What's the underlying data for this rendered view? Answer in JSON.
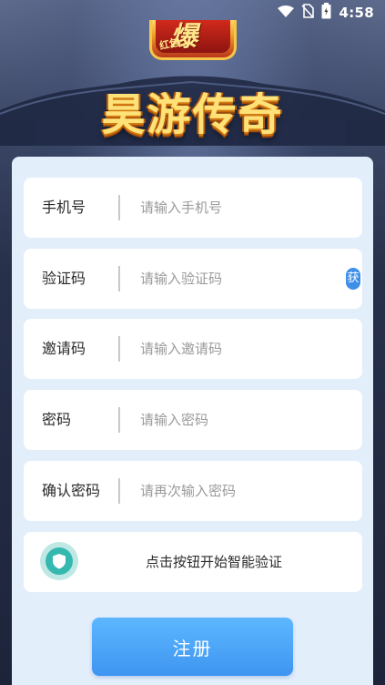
{
  "status_bar": {
    "time": "4:58",
    "icons": [
      "wifi-icon",
      "no-sim-icon",
      "battery-icon"
    ]
  },
  "header": {
    "logo_text": "爆",
    "logo_badge_text": "红包",
    "app_title": "昊游传奇"
  },
  "form": {
    "fields": [
      {
        "label": "手机号",
        "placeholder": "请输入手机号",
        "value": ""
      },
      {
        "label": "验证码",
        "placeholder": "请输入验证码",
        "value": "",
        "action_label": "获"
      },
      {
        "label": "邀请码",
        "placeholder": "请输入邀请码",
        "value": ""
      },
      {
        "label": "密码",
        "placeholder": "请输入密码",
        "value": ""
      },
      {
        "label": "确认密码",
        "placeholder": "请再次输入密码",
        "value": ""
      }
    ],
    "verify_text": "点击按钮开始智能验证",
    "verify_icon": "shield-icon",
    "register_label": "注册"
  },
  "colors": {
    "accent": "#3f95f0",
    "panel_bg": "#e3eefb",
    "title": "#ffe277",
    "shield": "#34b8b0"
  }
}
